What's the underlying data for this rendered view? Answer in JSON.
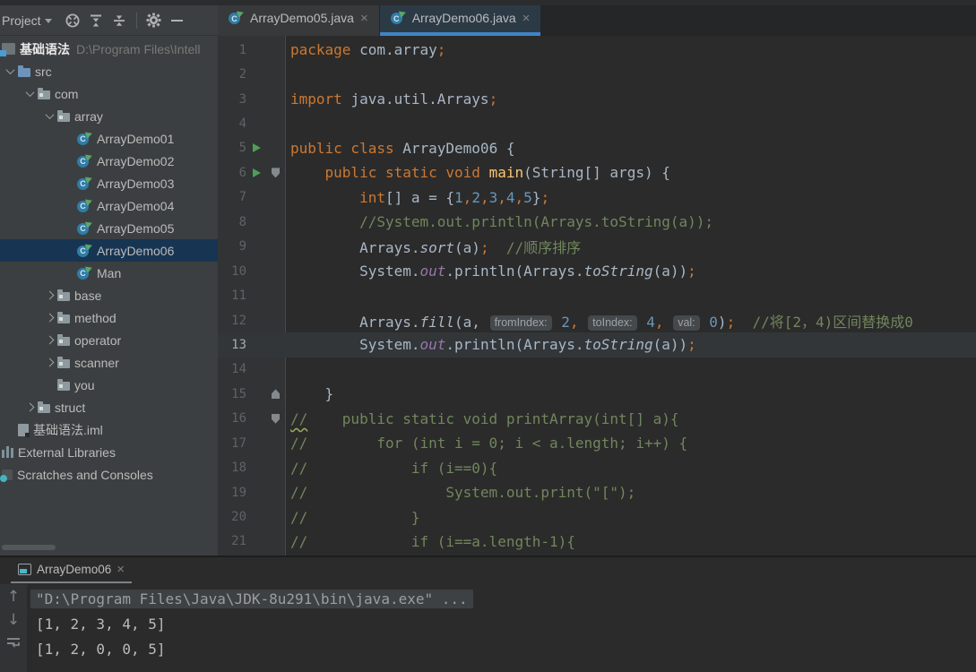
{
  "toolbar": {
    "project_label": "Project",
    "icons": [
      "select-opened-file",
      "expand-all",
      "collapse-all",
      "settings",
      "hide-panel"
    ]
  },
  "editor_tabs": [
    {
      "label": "ArrayDemo05.java",
      "active": false
    },
    {
      "label": "ArrayDemo06.java",
      "active": true
    }
  ],
  "project_tree": {
    "items": [
      {
        "label": "基础语法",
        "path": "D:\\Program Files\\Intell",
        "icon": "project",
        "level": 0,
        "chevron": "none",
        "bold": true,
        "selected": false
      },
      {
        "label": "src",
        "icon": "folder-src",
        "level": 1,
        "chevron": "down",
        "selected": false
      },
      {
        "label": "com",
        "icon": "package",
        "level": 2,
        "chevron": "down",
        "selected": false
      },
      {
        "label": "array",
        "icon": "package",
        "level": 3,
        "chevron": "down",
        "selected": false
      },
      {
        "label": "ArrayDemo01",
        "icon": "class",
        "level": 4,
        "chevron": "none",
        "selected": false
      },
      {
        "label": "ArrayDemo02",
        "icon": "class",
        "level": 4,
        "chevron": "none",
        "selected": false
      },
      {
        "label": "ArrayDemo03",
        "icon": "class",
        "level": 4,
        "chevron": "none",
        "selected": false
      },
      {
        "label": "ArrayDemo04",
        "icon": "class",
        "level": 4,
        "chevron": "none",
        "selected": false
      },
      {
        "label": "ArrayDemo05",
        "icon": "class",
        "level": 4,
        "chevron": "none",
        "selected": false
      },
      {
        "label": "ArrayDemo06",
        "icon": "class",
        "level": 4,
        "chevron": "none",
        "selected": true
      },
      {
        "label": "Man",
        "icon": "class",
        "level": 4,
        "chevron": "none",
        "selected": false
      },
      {
        "label": "base",
        "icon": "package",
        "level": 3,
        "chevron": "right",
        "selected": false
      },
      {
        "label": "method",
        "icon": "package",
        "level": 3,
        "chevron": "right",
        "selected": false
      },
      {
        "label": "operator",
        "icon": "package",
        "level": 3,
        "chevron": "right",
        "selected": false
      },
      {
        "label": "scanner",
        "icon": "package",
        "level": 3,
        "chevron": "right",
        "selected": false
      },
      {
        "label": "you",
        "icon": "package",
        "level": 3,
        "chevron": "none",
        "selected": false
      },
      {
        "label": "struct",
        "icon": "package",
        "level": 2,
        "chevron": "right",
        "selected": false
      },
      {
        "label": "基础语法.iml",
        "icon": "module",
        "level": 1,
        "chevron": "none",
        "selected": false
      },
      {
        "label": "External Libraries",
        "icon": "library",
        "level": 0,
        "chevron": "none",
        "selected": false
      },
      {
        "label": "Scratches and Consoles",
        "icon": "scratch",
        "level": 0,
        "chevron": "none",
        "selected": false
      }
    ]
  },
  "editor": {
    "lines": [
      {
        "n": 1,
        "tokens": [
          [
            "kw",
            "package "
          ],
          [
            "id",
            "com.array"
          ],
          [
            "pun",
            ";"
          ]
        ]
      },
      {
        "n": 2,
        "tokens": []
      },
      {
        "n": 3,
        "tokens": [
          [
            "kw",
            "import "
          ],
          [
            "id",
            "java.util.Arrays"
          ],
          [
            "pun",
            ";"
          ]
        ]
      },
      {
        "n": 4,
        "tokens": []
      },
      {
        "n": 5,
        "run": true,
        "tokens": [
          [
            "kw",
            "public class "
          ],
          [
            "id",
            "ArrayDemo06 {"
          ]
        ]
      },
      {
        "n": 6,
        "run": true,
        "fold": "down",
        "tokens": [
          [
            "id",
            "    "
          ],
          [
            "kw",
            "public static void "
          ],
          [
            "mtd",
            "main"
          ],
          [
            "id",
            "(String[] args) {"
          ]
        ]
      },
      {
        "n": 7,
        "tokens": [
          [
            "id",
            "        "
          ],
          [
            "kw",
            "int"
          ],
          [
            "id",
            "[] a = {"
          ],
          [
            "num",
            "1"
          ],
          [
            "pun",
            ","
          ],
          [
            "num",
            "2"
          ],
          [
            "pun",
            ","
          ],
          [
            "num",
            "3"
          ],
          [
            "pun",
            ","
          ],
          [
            "num",
            "4"
          ],
          [
            "pun",
            ","
          ],
          [
            "num",
            "5"
          ],
          [
            "id",
            "}"
          ],
          [
            "pun",
            ";"
          ]
        ]
      },
      {
        "n": 8,
        "tokens": [
          [
            "cmt",
            "        //System.out.println(Arrays.toString(a));"
          ]
        ]
      },
      {
        "n": 9,
        "tokens": [
          [
            "id",
            "        Arrays."
          ],
          [
            "sm",
            "sort"
          ],
          [
            "id",
            "(a)"
          ],
          [
            "pun",
            ";"
          ],
          [
            "cmt",
            "  //顺序排序"
          ]
        ]
      },
      {
        "n": 10,
        "tokens": [
          [
            "id",
            "        System."
          ],
          [
            "fld",
            "out"
          ],
          [
            "id",
            ".println(Arrays."
          ],
          [
            "sm",
            "toString"
          ],
          [
            "id",
            "(a))"
          ],
          [
            "pun",
            ";"
          ]
        ]
      },
      {
        "n": 11,
        "tokens": []
      },
      {
        "n": 12,
        "tokens": [
          [
            "id",
            "        Arrays."
          ],
          [
            "sm",
            "fill"
          ],
          [
            "id",
            "(a, "
          ],
          [
            "hint",
            "fromIndex:"
          ],
          [
            "num",
            " 2"
          ],
          [
            "pun",
            ","
          ],
          [
            "id",
            " "
          ],
          [
            "hint",
            "toIndex:"
          ],
          [
            "num",
            " 4"
          ],
          [
            "pun",
            ","
          ],
          [
            "id",
            " "
          ],
          [
            "hint",
            "val:"
          ],
          [
            "num",
            " 0"
          ],
          [
            "id",
            ")"
          ],
          [
            "pun",
            ";"
          ],
          [
            "cmt",
            "  //将[2，4)区间替换成0"
          ]
        ]
      },
      {
        "n": 13,
        "current": true,
        "tokens": [
          [
            "id",
            "        System."
          ],
          [
            "fld",
            "out"
          ],
          [
            "id",
            ".println(Arrays."
          ],
          [
            "sm",
            "toString"
          ],
          [
            "id",
            "(a))"
          ],
          [
            "pun",
            ";"
          ]
        ]
      },
      {
        "n": 14,
        "tokens": []
      },
      {
        "n": 15,
        "fold": "up",
        "tokens": [
          [
            "id",
            "    }"
          ]
        ]
      },
      {
        "n": 16,
        "fold": "down",
        "tokens": [
          [
            "cmtsq",
            "//"
          ],
          [
            "cmt",
            "    public static void printArray(int[] a){"
          ]
        ]
      },
      {
        "n": 17,
        "tokens": [
          [
            "cmt",
            "//        for (int i = 0; i < a.length; i++) {"
          ]
        ]
      },
      {
        "n": 18,
        "tokens": [
          [
            "cmt",
            "//            if (i==0){"
          ]
        ]
      },
      {
        "n": 19,
        "tokens": [
          [
            "cmt",
            "//                System.out.print(\"[\");"
          ]
        ]
      },
      {
        "n": 20,
        "tokens": [
          [
            "cmt",
            "//            }"
          ]
        ]
      },
      {
        "n": 21,
        "tokens": [
          [
            "cmt",
            "//            if (i==a.length-1){"
          ]
        ]
      }
    ]
  },
  "console": {
    "tab_label": "ArrayDemo06",
    "toolbar_icons": [
      "up-arrow",
      "down-arrow",
      "soft-wrap"
    ],
    "lines": [
      {
        "text": "\"D:\\Program Files\\Java\\JDK-8u291\\bin\\java.exe\" ...",
        "highlighted": true
      },
      {
        "text": "[1, 2, 3, 4, 5]",
        "highlighted": false
      },
      {
        "text": "[1, 2, 0, 0, 5]",
        "highlighted": false
      }
    ]
  },
  "colors": {
    "panel_bg": "#3C3F41",
    "editor_bg": "#2B2B2B",
    "selection_bg": "#173552",
    "active_tab_underline": "#4184C7",
    "keyword": "#CC7832",
    "number": "#6897BB",
    "comment": "#71865C",
    "field": "#9876AA",
    "method_decl": "#FFC66D",
    "run_green": "#4E9E54"
  }
}
